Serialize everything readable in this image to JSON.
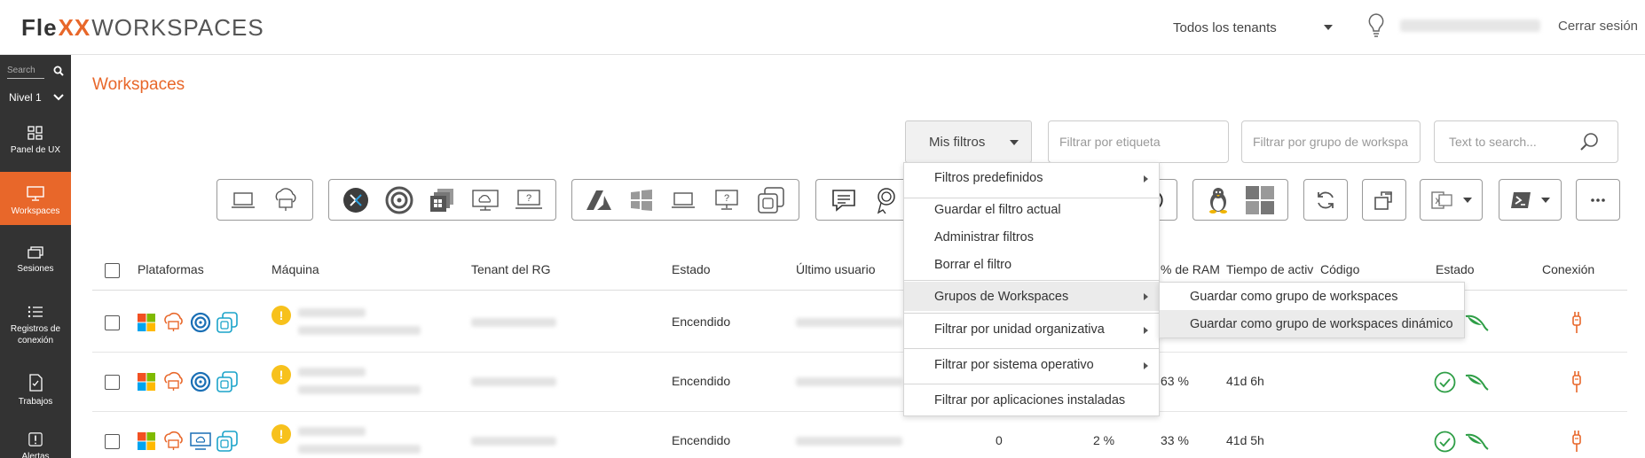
{
  "header": {
    "logo_left": "Fle",
    "logo_mark": "XX",
    "logo_right": "WORKSPACES",
    "tenant_select": "Todos los tenants",
    "logout": "Cerrar sesión"
  },
  "sidebar": {
    "search_placeholder": "Search",
    "level": "Nivel 1",
    "items": [
      {
        "label": "Panel de UX",
        "icon": "dashboard-icon"
      },
      {
        "label": "Workspaces",
        "icon": "monitor-icon",
        "active": true
      },
      {
        "label": "Sesiones",
        "icon": "sessions-icon"
      },
      {
        "label": "Registros de conexión",
        "icon": "list-icon"
      },
      {
        "label": "Trabajos",
        "icon": "jobs-icon"
      },
      {
        "label": "Alertas",
        "icon": "alert-icon"
      }
    ]
  },
  "page": {
    "title": "Workspaces"
  },
  "filters": {
    "my_filters": "Mis filtros",
    "tag_placeholder": "Filtrar por etiqueta",
    "group_placeholder": "Filtrar por grupo de workspa",
    "search_placeholder": "Text to search..."
  },
  "menu": {
    "items": [
      {
        "label": "Filtros predefinidos",
        "submenu": true
      },
      {
        "label": "Guardar el filtro actual"
      },
      {
        "label": "Administrar filtros"
      },
      {
        "label": "Borrar el filtro"
      },
      {
        "label": "Grupos de Workspaces",
        "submenu": true,
        "highlighted": true
      },
      {
        "label": "Filtrar por unidad organizativa",
        "submenu": true
      },
      {
        "label": "Filtrar por sistema operativo",
        "submenu": true
      },
      {
        "label": "Filtrar por aplicaciones instaladas"
      }
    ],
    "submenu": [
      {
        "label": "Guardar como grupo de workspaces"
      },
      {
        "label": "Guardar como grupo de workspaces dinámico",
        "highlighted": true
      }
    ]
  },
  "table": {
    "columns": [
      "Plataformas",
      "Máquina",
      "Tenant del RG",
      "Estado",
      "Último usuario",
      "% de RAM",
      "Tiempo de activ",
      "Código",
      "Estado",
      "Conexión"
    ],
    "rows": [
      {
        "estado": "Encendido",
        "ram": "",
        "uptime": "",
        "cpu_a": "",
        "cpu_b": ""
      },
      {
        "estado": "Encendido",
        "ram": "63 %",
        "uptime": "41d 6h",
        "cpu_a": "",
        "cpu_b": ""
      },
      {
        "estado": "Encendido",
        "ram": "33 %",
        "uptime": "41d 5h",
        "cpu_a": "0",
        "cpu_b": "2 %"
      }
    ]
  },
  "colors": {
    "accent": "#e8672a",
    "sidebar": "#333333",
    "warning": "#f7c11c",
    "ok": "#2e9e46"
  }
}
